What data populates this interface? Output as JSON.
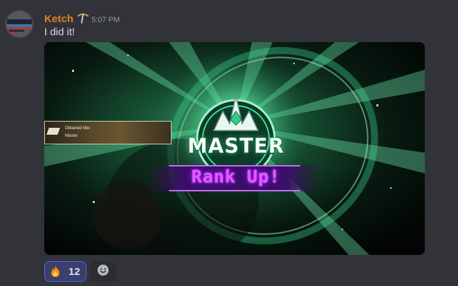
{
  "message": {
    "username": "Ketch",
    "username_color": "#e67e22",
    "role_icon": "pickaxe-role-icon",
    "timestamp": "5:07 PM",
    "text": "I did it!"
  },
  "attachment": {
    "title_card": {
      "line1": "Obtained title:",
      "line2": "Master"
    },
    "rank_label": "MASTER",
    "banner": "Rank Up!",
    "accent_green": "#3ee39a",
    "accent_purple": "#d85cff"
  },
  "reactions": [
    {
      "emoji": "fire-icon",
      "count": "12",
      "active": true
    }
  ],
  "add_reaction_icon": "smile-add-icon"
}
